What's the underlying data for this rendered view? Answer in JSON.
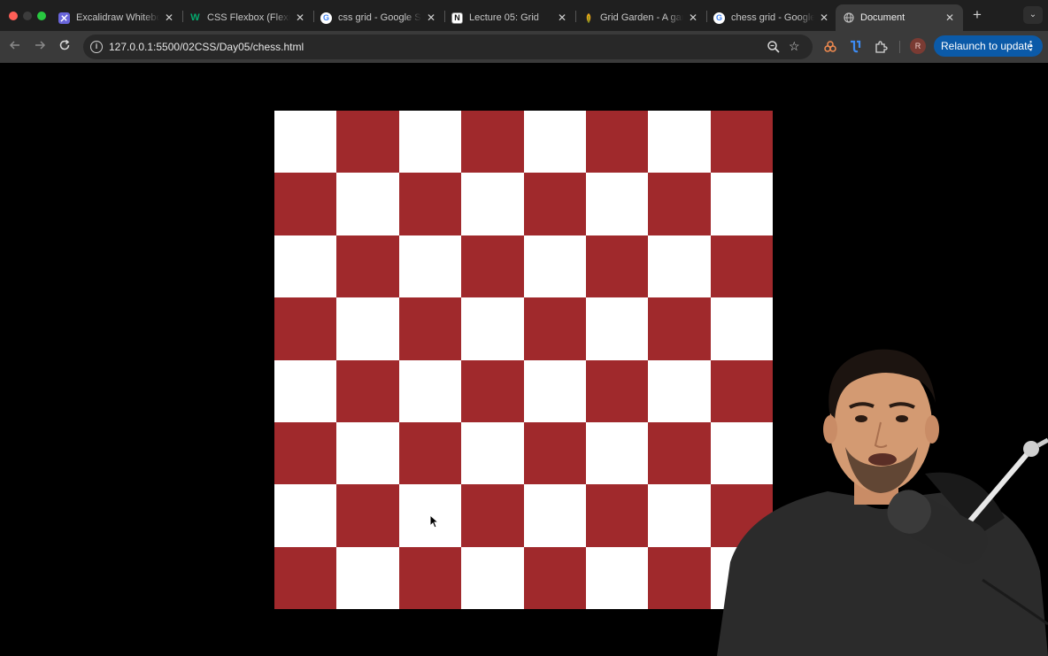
{
  "browser": {
    "tabs": [
      {
        "title": "Excalidraw Whiteboard",
        "favicon": "excalidraw-icon",
        "active": false
      },
      {
        "title": "CSS Flexbox (Flexible Box)",
        "favicon": "w3schools-icon",
        "active": false
      },
      {
        "title": "css grid - Google Search",
        "favicon": "google-icon",
        "active": false
      },
      {
        "title": "Lecture 05: Grid",
        "favicon": "notion-icon",
        "active": false
      },
      {
        "title": "Grid Garden - A game",
        "favicon": "grid-garden-icon",
        "active": false
      },
      {
        "title": "chess grid - Google Search",
        "favicon": "google-icon",
        "active": false
      },
      {
        "title": "Document",
        "favicon": "globe-icon",
        "active": true
      }
    ],
    "new_tab_label": "+",
    "address_bar": {
      "url": "127.0.0.1:5500/02CSS/Day05/chess.html"
    },
    "profile_initial": "R",
    "relaunch_label": "Relaunch to update"
  },
  "page": {
    "board": {
      "rows": 8,
      "columns": 8,
      "light_color": "#ffffff",
      "dark_color": "#a0292c",
      "top_left_square": "light"
    }
  },
  "colors": {
    "tabstrip": "#1f1f1f",
    "toolbar": "#3a3a3a",
    "page_background": "#000000",
    "relaunch_button": "#0b5aa8"
  }
}
